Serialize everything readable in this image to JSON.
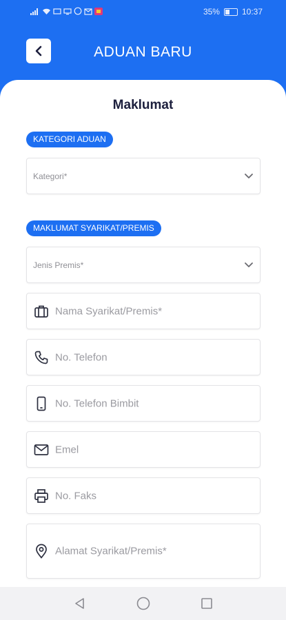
{
  "status_bar": {
    "battery": "35%",
    "battery_level": 0.35,
    "time": "10:37"
  },
  "header": {
    "title": "ADUAN BARU",
    "back_icon": "chevron-left-icon"
  },
  "form": {
    "section_title": "Maklumat",
    "kategori_section": {
      "label": "KATEGORI ADUAN",
      "kategori_placeholder": "Kategori*"
    },
    "syarikat_section": {
      "label": "MAKLUMAT SYARIKAT/PREMIS",
      "jenis_placeholder": "Jenis Premis*",
      "nama_placeholder": "Nama Syarikat/Premis*",
      "telefon_placeholder": "No. Telefon",
      "bimbit_placeholder": "No. Telefon Bimbit",
      "emel_placeholder": "Emel",
      "faks_placeholder": "No. Faks",
      "alamat_placeholder": "Alamat Syarikat/Premis*"
    }
  },
  "colors": {
    "primary": "#1d6ff2",
    "title_text": "#1c1f3d",
    "placeholder": "#9a9aa0"
  },
  "nav": {
    "back": "triangle-back-icon",
    "home": "circle-home-icon",
    "recents": "square-recents-icon"
  }
}
